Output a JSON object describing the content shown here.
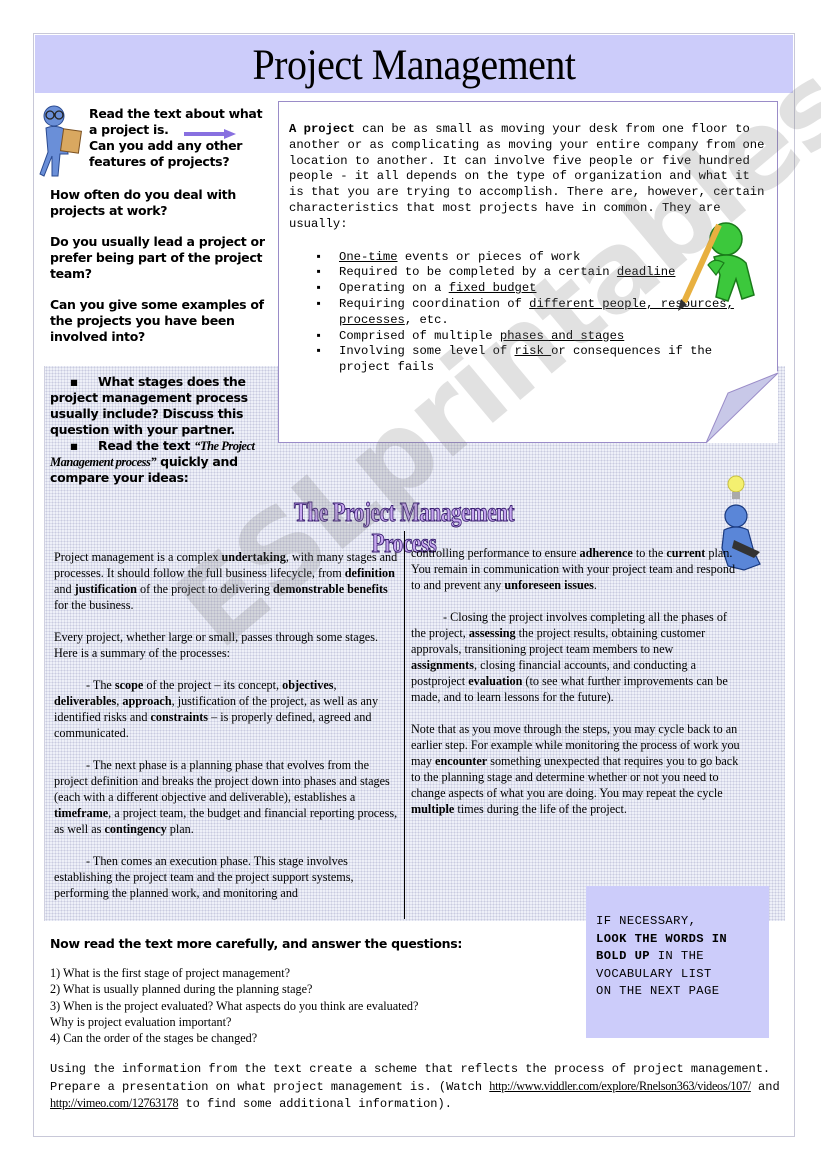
{
  "title": "Project Management",
  "intro": {
    "line1": "Read the text about what a project is.",
    "line2": "Can you add any other features of projects?",
    "questions": [
      "How often do you deal with projects at work?",
      "Do you usually lead a project or prefer being part of the project team?",
      "Can you give some examples of the projects you have been involved into?"
    ]
  },
  "note": {
    "lead_bold": "A project",
    "lead_rest": " can be as small as moving your desk from one floor to another or as complicating as moving your entire company from one location to another. It can involve five people or five hundred people - it all depends on the type of organization and what it is that you are trying to accomplish.  There are, however, certain characteristics that most projects have in common. They are usually:",
    "items": [
      {
        "pre": "",
        "u": "One-time",
        "post": " events or pieces of work"
      },
      {
        "pre": "Required to be completed by a certain ",
        "u": "deadline",
        "post": ""
      },
      {
        "pre": "Operating on a ",
        "u": "fixed budget",
        "post": ""
      },
      {
        "pre": "Requiring coordination of ",
        "u": "different people, resources, processes",
        "post": ", etc."
      },
      {
        "pre": "Comprised of multiple ",
        "u": "phases and stages",
        "post": ""
      },
      {
        "pre": "Involving some level of ",
        "u": "risk ",
        "post": "or consequences if the project fails"
      }
    ]
  },
  "stages": {
    "bullet": "▪",
    "q1": "What stages does the project management process usually include? Discuss this question with your partner.",
    "q2_pre": "Read the text ",
    "q2_italic": "“The Project Management process”",
    "q2_post": " quickly and compare your ideas:"
  },
  "process_title": "The Project Management Process",
  "process": {
    "p1": [
      "Project management is a complex ",
      {
        "b": "undertaking"
      },
      ", with many stages and processes. It should follow the full business lifecycle, from ",
      {
        "b": "definition"
      },
      " and ",
      {
        "b": "justification"
      },
      " of the project to delivering ",
      {
        "b": "demonstrable benefits"
      },
      " for the business."
    ],
    "p2": [
      "Every project, whether large or small, passes through some stages. Here is a summary of the processes:"
    ],
    "p3": [
      "- The ",
      {
        "b": "scope"
      },
      " of the project – its concept, ",
      {
        "b": "objectives"
      },
      ", ",
      {
        "b": "deliverables"
      },
      ", ",
      {
        "b": "approach"
      },
      ", justification of the project, as well as any identified risks and ",
      {
        "b": "constraints"
      },
      " – is properly defined, agreed and communicated."
    ],
    "p4": [
      "- The next phase is a planning phase that evolves from the project definition and breaks the project down into phases and stages (each with a different objective and deliverable), establishes a ",
      {
        "b": "timeframe"
      },
      ", a project team, the budget and financial reporting process, as well as ",
      {
        "b": "contingency"
      },
      " plan."
    ],
    "p5": [
      "- Then comes an execution phase. This stage involves establishing the project team and the project support systems, performing the planned work, and monitoring and"
    ],
    "p6": [
      "controlling performance to ensure ",
      {
        "b": "adherence"
      },
      " to the ",
      {
        "b": "current"
      },
      " plan. You remain in communication with your project team and respond to and prevent any ",
      {
        "b": "unforeseen issues"
      },
      "."
    ],
    "p7": [
      "- Closing the project involves completing all the phases of the project, ",
      {
        "b": "assessing"
      },
      " the project results, obtaining customer approvals, transitioning project team members  to new ",
      {
        "b": "assignments"
      },
      ", closing financial accounts, and conducting a postproject ",
      {
        "b": "evaluation"
      },
      " (to see what further improvements can be made, and to learn lessons for the future)."
    ],
    "p8": [
      "Note that as you move through the steps, you may cycle back to an earlier step. For example while monitoring the process of work you may ",
      {
        "b": "encounter"
      },
      " something unexpected that requires you to go back to the planning stage and determine whether or not you need to change aspects of what you are doing.  You may repeat the cycle ",
      {
        "b": "multiple"
      },
      " times during the life of the project."
    ]
  },
  "vocab": {
    "l1": "IF NECESSARY,",
    "l2": "LOOK THE WORDS IN",
    "l3_bold": "BOLD UP",
    "l3_rest": " IN THE",
    "l4": "VOCABULARY LIST",
    "l5": "ON THE NEXT PAGE"
  },
  "questions": {
    "heading": "Now read the text more carefully, and answer the questions:",
    "items": [
      "1) What is the first stage of project management?",
      "2) What is usually planned during the planning stage?",
      "3) When is the project evaluated? What aspects do you think are evaluated?",
      "Why is project evaluation important?",
      "4) Can the order of the stages be changed?"
    ]
  },
  "task": {
    "text1": "Using the information from the text create a scheme that reflects the process of project management. Prepare a presentation on what project management is. (Watch ",
    "link1": "http://www.viddler.com/explore/Rnelson363/videos/107/",
    "and": " and ",
    "link2": "http://vimeo.com/12763178",
    "text2": "  to find some additional information)."
  },
  "watermark": "ESLprintables.com",
  "colors": {
    "title_bg": "#ccccfa",
    "vocab_bg": "#ccccfa",
    "arrow": "#8870e0",
    "note_border": "#9a8cc8"
  }
}
